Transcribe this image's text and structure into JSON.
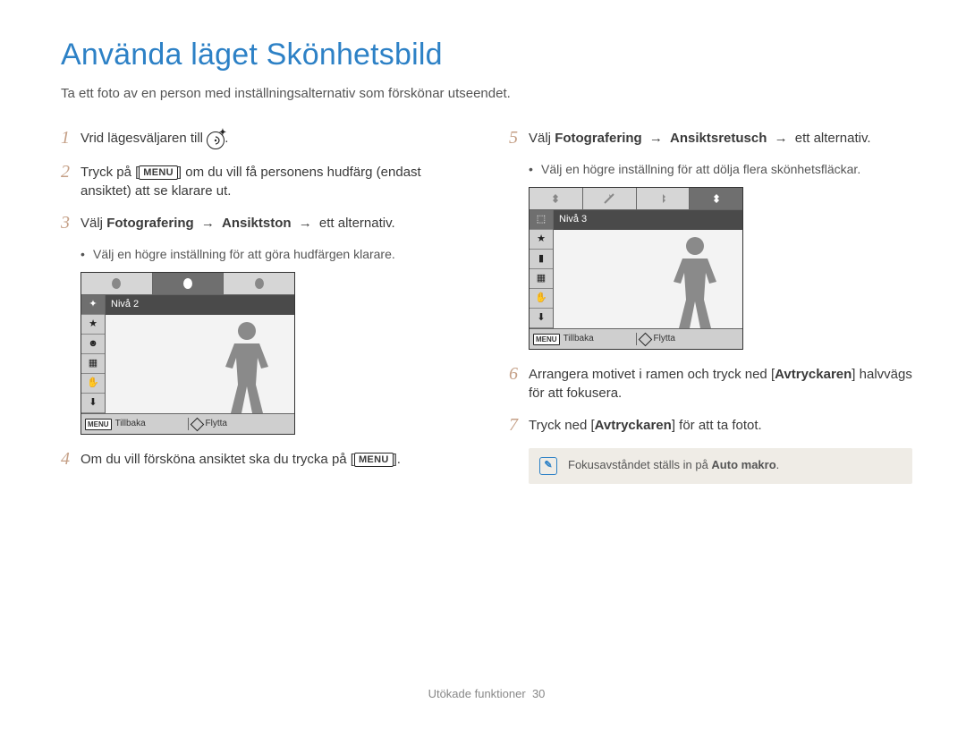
{
  "title": "Använda läget Skönhetsbild",
  "intro": "Ta ett foto av en person med inställningsalternativ som förskönar utseendet.",
  "menu_label": "MENU",
  "arrow": "→",
  "left_steps": {
    "s1": {
      "num": "1",
      "pre": "Vrid lägesväljaren till ",
      "post": "."
    },
    "s2": {
      "num": "2",
      "pre": "Tryck på [",
      "post": "] om du vill få personens hudfärg (endast ansiktet) att se klarare ut."
    },
    "s3": {
      "num": "3",
      "a": "Välj ",
      "b": "Fotografering",
      "c": "Ansiktston",
      "d": "ett alternativ."
    },
    "s3_sub": "Välj en högre inställning för att göra hudfärgen klarare.",
    "s4": {
      "num": "4",
      "pre": "Om du vill försköna ansiktet ska du trycka på [",
      "post": "]."
    }
  },
  "right_steps": {
    "s5": {
      "num": "5",
      "a": "Välj ",
      "b": "Fotografering",
      "c": "Ansiktsretusch",
      "d": "ett alternativ."
    },
    "s5_sub": "Välj en högre inställning för att dölja flera skönhetsfläckar.",
    "s6": {
      "num": "6",
      "pre": "Arrangera motivet i ramen och tryck ned [",
      "btn": "Avtryckaren",
      "post": "] halvvägs för att fokusera."
    },
    "s7": {
      "num": "7",
      "pre": "Tryck ned [",
      "btn": "Avtryckaren",
      "post": "] för att ta fotot."
    }
  },
  "camshot_left": {
    "level_label": "Nivå 2",
    "back": "Tillbaka",
    "move": "Flytta"
  },
  "camshot_right": {
    "level_label": "Nivå 3",
    "back": "Tillbaka",
    "move": "Flytta"
  },
  "note": {
    "pre": "Fokusavståndet ställs in på ",
    "bold": "Auto makro",
    "post": "."
  },
  "footer": {
    "section": "Utökade funktioner",
    "page": "30"
  }
}
